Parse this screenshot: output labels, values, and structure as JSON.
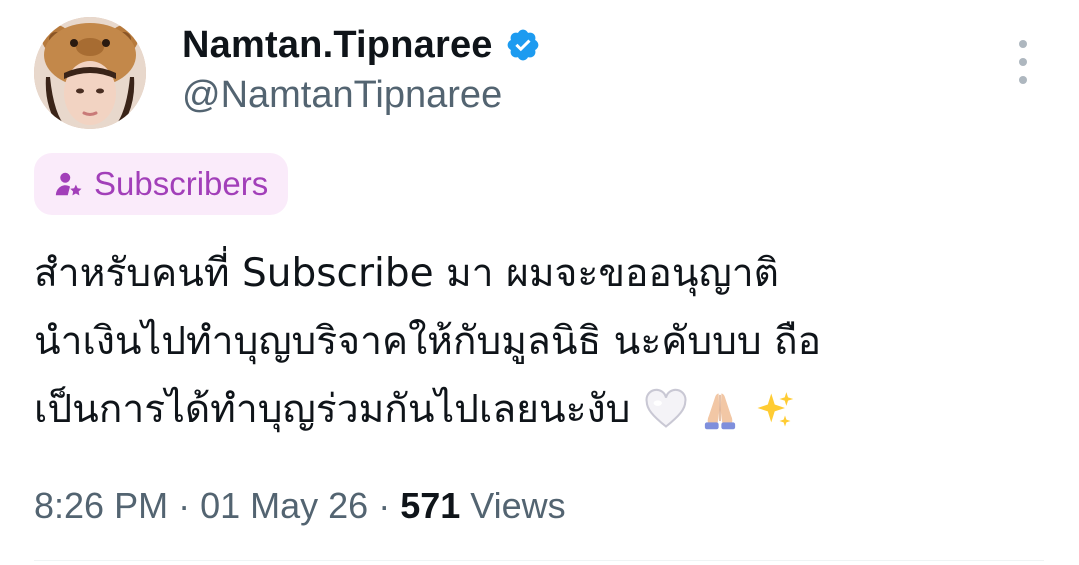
{
  "author": {
    "display_name": "Namtan.Tipnaree",
    "handle": "@NamtanTipnaree",
    "verified": true,
    "verified_color": "#1d9bf0",
    "avatar_icon": "bear-hat-avatar"
  },
  "badge": {
    "label": "Subscribers",
    "icon": "subscriber-star-icon",
    "text_color": "#a23fb9",
    "background": "#faebfa"
  },
  "tweet": {
    "lines": [
      "สำหรับคนที่ Subscribe มา  ผมจะขออนุญาติ",
      "นำเงินไปทำบุญบริจาคให้กับมูลนิธิ นะคับบบ ถือ",
      "เป็นการได้ทำบุญร่วมกันไปเลยนะงับ"
    ],
    "emojis": [
      "white-heart-icon",
      "folded-hands-icon",
      "sparkles-icon"
    ]
  },
  "meta": {
    "time": "8:26 PM",
    "separator": "·",
    "date": "01 May 26",
    "views_count": "571",
    "views_label": "Views"
  },
  "more_menu": {
    "icon": "more-vertical-icon"
  }
}
